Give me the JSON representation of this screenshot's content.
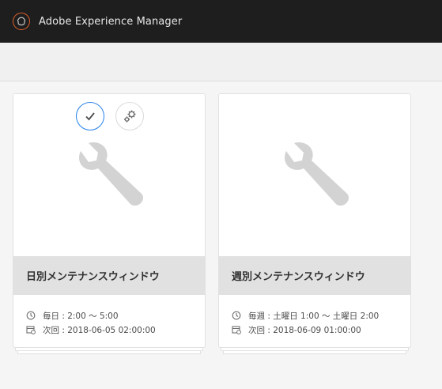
{
  "app": {
    "title": "Adobe Experience Manager",
    "logo_icon": "adobe-logo-icon"
  },
  "colors": {
    "header_bg": "#1e1e1e",
    "accent": "#2680eb",
    "logo": "#e0602b",
    "title_bar": "#e1e1e1"
  },
  "cards": [
    {
      "title": "日別メンテナンスウィンドウ",
      "icon": "wrench-icon",
      "schedule": "毎日 : 2:00 〜 5:00",
      "next_run": "次回 : 2018-06-05 02:00:00",
      "quick_actions": [
        "check-icon",
        "gear-icon"
      ]
    },
    {
      "title": "週別メンテナンスウィンドウ",
      "icon": "wrench-icon",
      "schedule": "毎週 : 土曜日 1:00 〜 土曜日 2:00",
      "next_run": "次回 : 2018-06-09 01:00:00"
    }
  ]
}
